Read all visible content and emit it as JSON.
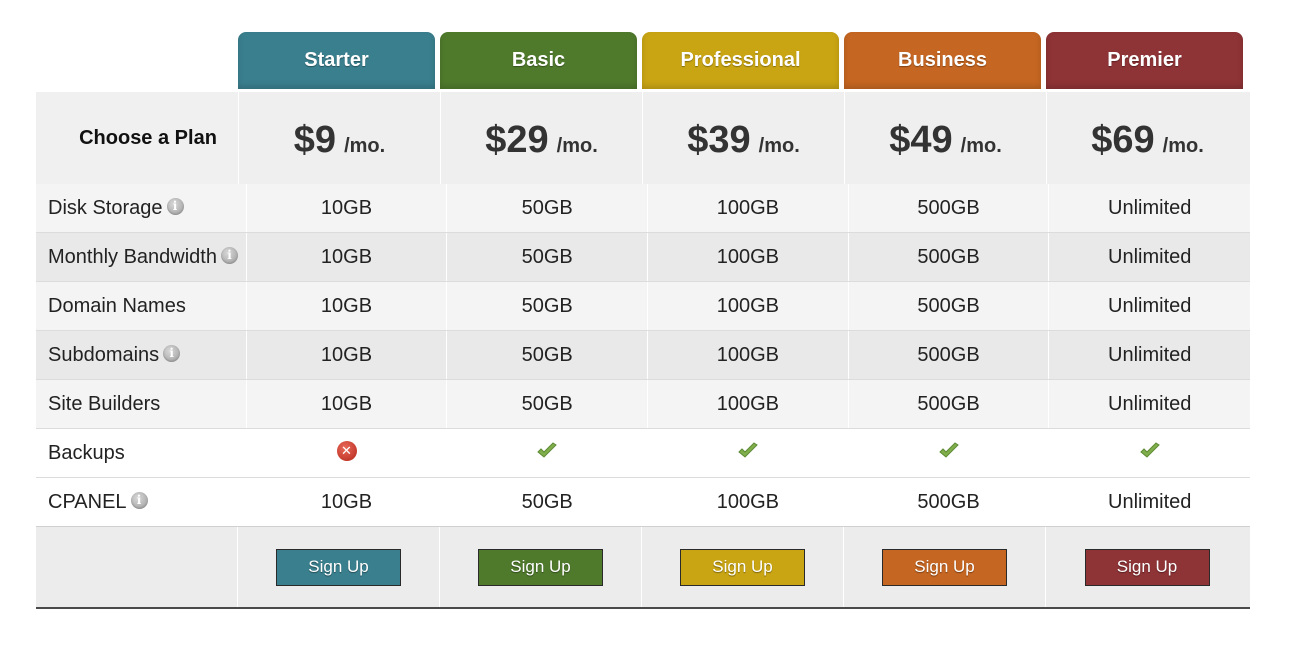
{
  "plans": [
    {
      "name": "Starter",
      "price": "$9",
      "unit": "/mo.",
      "color": "#3a7f8e"
    },
    {
      "name": "Basic",
      "price": "$29",
      "unit": "/mo.",
      "color": "#4f7a2c"
    },
    {
      "name": "Professional",
      "price": "$39",
      "unit": "/mo.",
      "color": "#c9a514"
    },
    {
      "name": "Business",
      "price": "$49",
      "unit": "/mo.",
      "color": "#c56622"
    },
    {
      "name": "Premier",
      "price": "$69",
      "unit": "/mo.",
      "color": "#8e3336"
    }
  ],
  "choose_label": "Choose a Plan",
  "features": [
    {
      "name": "Disk Storage",
      "info": true,
      "values": [
        "10GB",
        "50GB",
        "100GB",
        "500GB",
        "Unlimited"
      ]
    },
    {
      "name": "Monthly Bandwidth",
      "info": true,
      "values": [
        "10GB",
        "50GB",
        "100GB",
        "500GB",
        "Unlimited"
      ]
    },
    {
      "name": "Domain Names",
      "info": false,
      "values": [
        "10GB",
        "50GB",
        "100GB",
        "500GB",
        "Unlimited"
      ]
    },
    {
      "name": "Subdomains",
      "info": true,
      "values": [
        "10GB",
        "50GB",
        "100GB",
        "500GB",
        "Unlimited"
      ]
    },
    {
      "name": "Site Builders",
      "info": false,
      "values": [
        "10GB",
        "50GB",
        "100GB",
        "500GB",
        "Unlimited"
      ]
    },
    {
      "name": "Backups",
      "info": false,
      "values": [
        "no",
        "yes",
        "yes",
        "yes",
        "yes"
      ]
    },
    {
      "name": "CPANEL",
      "info": true,
      "values": [
        "10GB",
        "50GB",
        "100GB",
        "500GB",
        "Unlimited"
      ]
    }
  ],
  "signup_label": "Sign Up",
  "icons": {
    "info": "info-icon",
    "yes": "check-icon",
    "no": "x-circle-icon"
  }
}
